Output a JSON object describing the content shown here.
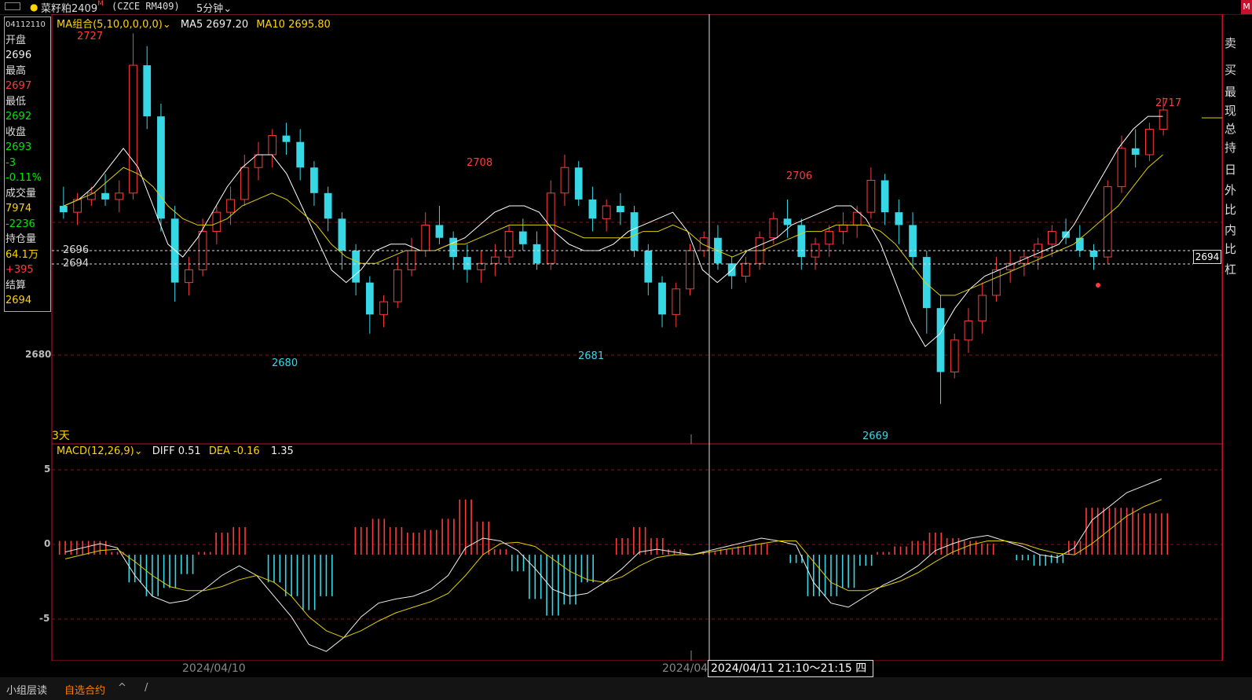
{
  "header": {
    "symbol": "菜籽粕2409",
    "symbol_sup": "M",
    "code": "(CZCE RM409)",
    "period": "5分钟",
    "right_tab": "M"
  },
  "infobox": {
    "date": "04112110",
    "open_label": "开盘",
    "open": "2696",
    "high_label": "最高",
    "high": "2697",
    "low_label": "最低",
    "low": "2692",
    "close_label": "收盘",
    "close": "2693",
    "change": "-3",
    "change_pct": "-0.11%",
    "volume_label": "成交量",
    "volume": "7974",
    "volume_change": "-2236",
    "oi_label": "持仓量",
    "oi": "64.1万",
    "oi_change": "+395",
    "settle_label": "结算",
    "settle": "2694"
  },
  "main_legend": {
    "ma_group": "MA组合(5,10,0,0,0,0)",
    "ma5": "MA5 2697.20",
    "ma10": "MA10 2695.80",
    "days": "3天"
  },
  "macd_legend": {
    "name": "MACD(12,26,9)",
    "diff": "DIFF 0.51",
    "dea": "DEA -0.16",
    "macd": "1.35"
  },
  "price_axis": {
    "p2696": "2696",
    "p2694": "2694",
    "p2680": "2680"
  },
  "macd_axis": {
    "p5": "5",
    "p0": "0",
    "m5": "-5"
  },
  "annotations": {
    "h1": "2727",
    "h2": "2708",
    "h3": "2706",
    "h4": "2717",
    "l1": "2680",
    "l2": "2681",
    "l3": "2669"
  },
  "price_tag": "2694",
  "time_axis": {
    "d1": "2024/04/10",
    "d2": "2024/04/",
    "crosshair": "2024/04/11 21:10～21:15 四"
  },
  "right_panel": [
    "卖",
    "买",
    "最",
    "现",
    "总",
    "持",
    "日",
    "外",
    "比",
    "内",
    "比",
    "杠"
  ],
  "bottom": {
    "a": "小组层读",
    "b": "自选合约",
    "c": "^",
    "d": "/"
  },
  "colors": {
    "up": "#ff3b3b",
    "down": "#37d7e5",
    "ma5": "#ffffff",
    "ma10": "#e0d000",
    "grid": "#8b1010"
  },
  "chart_data": {
    "type": "candlestick",
    "ohlc": [
      [
        2700,
        2703,
        2698,
        2699
      ],
      [
        2699,
        2702,
        2697,
        2701
      ],
      [
        2701,
        2703,
        2700,
        2702
      ],
      [
        2702,
        2705,
        2700,
        2701
      ],
      [
        2701,
        2704,
        2699,
        2702
      ],
      [
        2702,
        2727,
        2701,
        2722
      ],
      [
        2722,
        2725,
        2712,
        2714
      ],
      [
        2714,
        2716,
        2696,
        2698
      ],
      [
        2698,
        2700,
        2685,
        2688
      ],
      [
        2688,
        2692,
        2686,
        2690
      ],
      [
        2690,
        2698,
        2689,
        2696
      ],
      [
        2696,
        2700,
        2694,
        2699
      ],
      [
        2699,
        2703,
        2697,
        2701
      ],
      [
        2701,
        2708,
        2700,
        2706
      ],
      [
        2706,
        2710,
        2704,
        2708
      ],
      [
        2708,
        2712,
        2706,
        2711
      ],
      [
        2711,
        2713,
        2708,
        2710
      ],
      [
        2710,
        2712,
        2704,
        2706
      ],
      [
        2706,
        2707,
        2700,
        2702
      ],
      [
        2702,
        2703,
        2696,
        2698
      ],
      [
        2698,
        2699,
        2690,
        2693
      ],
      [
        2693,
        2694,
        2686,
        2688
      ],
      [
        2688,
        2689,
        2680,
        2683
      ],
      [
        2683,
        2686,
        2681,
        2685
      ],
      [
        2685,
        2692,
        2684,
        2690
      ],
      [
        2690,
        2695,
        2689,
        2693
      ],
      [
        2693,
        2699,
        2692,
        2697
      ],
      [
        2697,
        2700,
        2694,
        2695
      ],
      [
        2695,
        2696,
        2690,
        2692
      ],
      [
        2692,
        2694,
        2688,
        2690
      ],
      [
        2690,
        2693,
        2688,
        2691
      ],
      [
        2691,
        2694,
        2689,
        2692
      ],
      [
        2692,
        2697,
        2691,
        2696
      ],
      [
        2696,
        2698,
        2693,
        2694
      ],
      [
        2694,
        2696,
        2690,
        2691
      ],
      [
        2691,
        2704,
        2690,
        2702
      ],
      [
        2702,
        2708,
        2700,
        2706
      ],
      [
        2706,
        2707,
        2700,
        2701
      ],
      [
        2701,
        2703,
        2696,
        2698
      ],
      [
        2698,
        2701,
        2696,
        2700
      ],
      [
        2700,
        2702,
        2697,
        2699
      ],
      [
        2699,
        2700,
        2692,
        2693
      ],
      [
        2693,
        2694,
        2686,
        2688
      ],
      [
        2688,
        2689,
        2681,
        2683
      ],
      [
        2683,
        2688,
        2681,
        2687
      ],
      [
        2687,
        2694,
        2686,
        2693
      ],
      [
        2693,
        2696,
        2692,
        2695
      ],
      [
        2695,
        2697,
        2690,
        2691
      ],
      [
        2691,
        2692,
        2687,
        2689
      ],
      [
        2689,
        2692,
        2688,
        2691
      ],
      [
        2691,
        2696,
        2690,
        2695
      ],
      [
        2695,
        2699,
        2694,
        2698
      ],
      [
        2698,
        2701,
        2695,
        2697
      ],
      [
        2697,
        2698,
        2690,
        2692
      ],
      [
        2692,
        2695,
        2690,
        2694
      ],
      [
        2694,
        2697,
        2692,
        2696
      ],
      [
        2696,
        2699,
        2694,
        2697
      ],
      [
        2697,
        2700,
        2695,
        2699
      ],
      [
        2699,
        2706,
        2698,
        2704
      ],
      [
        2704,
        2705,
        2697,
        2699
      ],
      [
        2699,
        2701,
        2694,
        2697
      ],
      [
        2697,
        2699,
        2690,
        2692
      ],
      [
        2692,
        2693,
        2680,
        2684
      ],
      [
        2684,
        2686,
        2669,
        2674
      ],
      [
        2674,
        2680,
        2673,
        2679
      ],
      [
        2679,
        2684,
        2677,
        2682
      ],
      [
        2682,
        2688,
        2680,
        2686
      ],
      [
        2686,
        2692,
        2685,
        2690
      ],
      [
        2690,
        2693,
        2688,
        2691
      ],
      [
        2691,
        2693,
        2689,
        2692
      ],
      [
        2692,
        2695,
        2690,
        2694
      ],
      [
        2694,
        2697,
        2692,
        2696
      ],
      [
        2696,
        2698,
        2694,
        2695
      ],
      [
        2695,
        2697,
        2692,
        2693
      ],
      [
        2693,
        2694,
        2690,
        2692
      ],
      [
        2692,
        2704,
        2691,
        2703
      ],
      [
        2703,
        2711,
        2702,
        2709
      ],
      [
        2709,
        2712,
        2706,
        2708
      ],
      [
        2708,
        2713,
        2707,
        2712
      ],
      [
        2712,
        2717,
        2711,
        2715
      ]
    ],
    "ma5": [
      2700,
      2701,
      2703,
      2706,
      2709,
      2706,
      2700,
      2694,
      2692,
      2695,
      2699,
      2703,
      2706,
      2708,
      2708,
      2705,
      2700,
      2695,
      2690,
      2688,
      2690,
      2693,
      2694,
      2694,
      2693,
      2693,
      2694,
      2695,
      2697,
      2699,
      2700,
      2700,
      2699,
      2696,
      2694,
      2693,
      2693,
      2694,
      2696,
      2697,
      2698,
      2699,
      2696,
      2690,
      2688,
      2690,
      2693,
      2694,
      2695,
      2697,
      2698,
      2699,
      2700,
      2700,
      2698,
      2694,
      2688,
      2682,
      2678,
      2680,
      2684,
      2687,
      2689,
      2690,
      2691,
      2692,
      2693,
      2694,
      2697,
      2701,
      2705,
      2709,
      2712,
      2714,
      2714
    ],
    "ma10": [
      2700,
      2701,
      2702,
      2704,
      2706,
      2705,
      2703,
      2700,
      2698,
      2697,
      2697,
      2698,
      2700,
      2701,
      2702,
      2701,
      2699,
      2697,
      2694,
      2692,
      2691,
      2691,
      2692,
      2693,
      2693,
      2693,
      2694,
      2694,
      2695,
      2696,
      2697,
      2697,
      2697,
      2697,
      2696,
      2695,
      2695,
      2695,
      2695,
      2696,
      2696,
      2697,
      2696,
      2694,
      2693,
      2692,
      2693,
      2693,
      2694,
      2695,
      2696,
      2696,
      2697,
      2697,
      2697,
      2696,
      2694,
      2691,
      2688,
      2686,
      2686,
      2687,
      2688,
      2689,
      2690,
      2691,
      2692,
      2693,
      2694,
      2696,
      2698,
      2700,
      2703,
      2706,
      2708
    ],
    "macd_diff": [
      0.2,
      0.5,
      0.8,
      0.5,
      -1.5,
      -3.0,
      -3.5,
      -3.3,
      -2.5,
      -1.5,
      -0.8,
      -1.5,
      -3.0,
      -4.5,
      -6.5,
      -7.0,
      -6.0,
      -4.5,
      -3.5,
      -3.2,
      -3.0,
      -2.5,
      -1.5,
      0.5,
      1.2,
      1.0,
      0.3,
      -1.0,
      -2.5,
      -3.0,
      -2.8,
      -2.0,
      -1.0,
      0.2,
      0.4,
      0.2,
      0.0,
      0.3,
      0.6,
      0.9,
      1.2,
      1.0,
      0.7,
      -2.0,
      -3.5,
      -3.8,
      -3.0,
      -2.2,
      -1.6,
      -0.8,
      0.3,
      0.8,
      1.2,
      1.4,
      1.0,
      0.6,
      0.0,
      -0.2,
      0.5,
      2.5,
      3.5,
      4.5,
      5.0,
      5.5
    ],
    "macd_dea": [
      -0.3,
      0.0,
      0.3,
      0.4,
      -0.5,
      -1.5,
      -2.3,
      -2.6,
      -2.6,
      -2.3,
      -1.8,
      -1.5,
      -2.0,
      -3.0,
      -4.5,
      -5.5,
      -6.0,
      -5.5,
      -4.8,
      -4.2,
      -3.8,
      -3.4,
      -2.8,
      -1.5,
      0.0,
      0.8,
      0.9,
      0.6,
      -0.3,
      -1.2,
      -1.8,
      -2.0,
      -1.6,
      -0.8,
      -0.2,
      0.0,
      0.0,
      0.2,
      0.4,
      0.6,
      0.8,
      1.0,
      1.0,
      -0.5,
      -2.0,
      -2.6,
      -2.6,
      -2.3,
      -1.9,
      -1.3,
      -0.5,
      0.2,
      0.7,
      1.0,
      1.0,
      0.8,
      0.4,
      0.1,
      0.0,
      0.8,
      1.8,
      2.8,
      3.5,
      4.0
    ],
    "macd_ylim": [
      -7.5,
      7
    ],
    "price_ylim": [
      2663,
      2730
    ]
  }
}
